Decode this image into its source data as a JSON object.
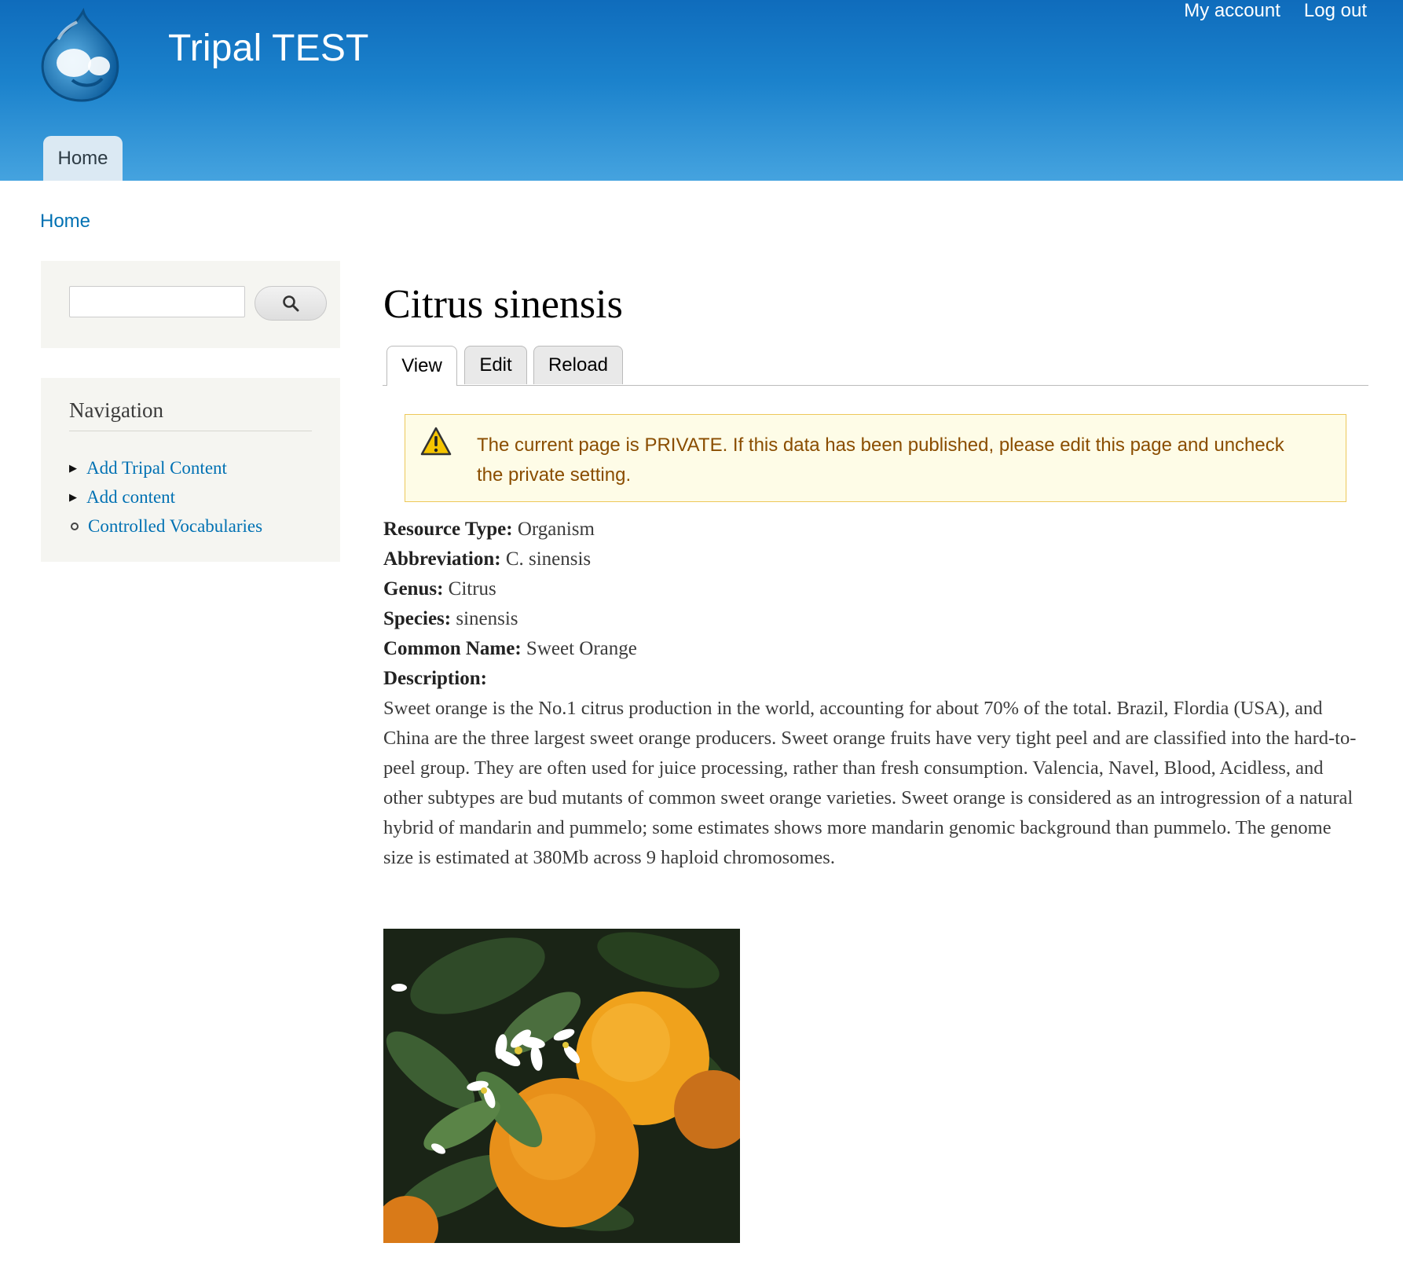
{
  "site": {
    "name": "Tripal TEST"
  },
  "secondary_menu": {
    "my_account": "My account",
    "log_out": "Log out"
  },
  "main_menu": {
    "home": "Home"
  },
  "breadcrumb": {
    "home": "Home"
  },
  "search": {
    "value": "",
    "placeholder": ""
  },
  "navigation": {
    "title": "Navigation",
    "items": [
      {
        "label": "Add Tripal Content"
      },
      {
        "label": "Add content"
      },
      {
        "label": "Controlled Vocabularies"
      }
    ]
  },
  "page": {
    "title": "Citrus sinensis",
    "tabs": [
      {
        "label": "View"
      },
      {
        "label": "Edit"
      },
      {
        "label": "Reload"
      }
    ],
    "warning": "The current page is PRIVATE. If this data has been published, please edit this page and uncheck the private setting.",
    "fields": [
      {
        "label": "Resource Type:",
        "value": "Organism"
      },
      {
        "label": "Abbreviation:",
        "value": "C. sinensis"
      },
      {
        "label": "Genus:",
        "value": "Citrus"
      },
      {
        "label": "Species:",
        "value": "sinensis"
      },
      {
        "label": "Common Name:",
        "value": "Sweet Orange"
      },
      {
        "label": "Description:",
        "value": ""
      }
    ],
    "description": "Sweet orange is the No.1 citrus production in the world, accounting for about 70% of the total. Brazil, Flordia (USA), and China are the three largest sweet orange producers. Sweet orange fruits have very tight peel and are classified into the hard-to-peel group. They are often used for juice processing, rather than fresh consumption. Valencia, Navel, Blood, Acidless, and other subtypes are bud mutants of common sweet orange varieties. Sweet orange is considered as an introgression of a natural hybrid of mandarin and pummelo; some estimates shows more mandarin genomic background than pummelo. The genome size is estimated at 380Mb across 9 haploid chromosomes."
  },
  "colors": {
    "header_top": "#0f6cbc",
    "header_bottom": "#45a3df",
    "link": "#0071b3",
    "warning_text": "#8a4d00",
    "warning_bg": "#fefce7",
    "warning_border": "#edc85a",
    "sidebar_bg": "#f5f5f1"
  },
  "icons": {
    "logo": "drupal-drop-logo",
    "search": "search-icon",
    "warning": "warning-triangle-icon",
    "nav_expand": "triangle-right-icon",
    "nav_leaf": "circle-bullet-icon"
  }
}
